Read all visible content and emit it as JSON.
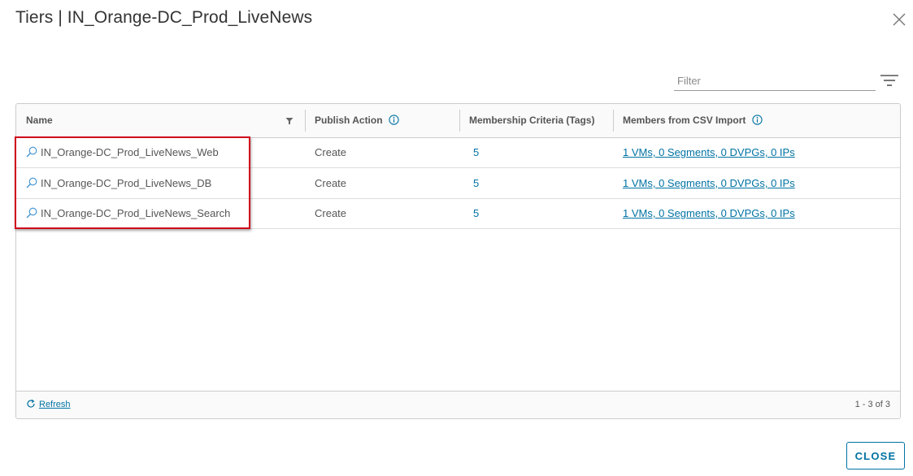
{
  "modal": {
    "title": "Tiers | IN_Orange-DC_Prod_LiveNews",
    "close_icon": "close-icon",
    "close_button_label": "CLOSE"
  },
  "filter": {
    "placeholder": "Filter",
    "value": "",
    "toggle_icon": "filter-lines-icon"
  },
  "grid": {
    "columns": [
      {
        "label": "Name",
        "icon": "filter-funnel-icon"
      },
      {
        "label": "Publish Action",
        "icon": "info-icon"
      },
      {
        "label": "Membership Criteria (Tags)"
      },
      {
        "label": "Members from CSV Import",
        "icon": "info-icon"
      }
    ],
    "rows": [
      {
        "name": "IN_Orange-DC_Prod_LiveNews_Web",
        "publish_action": "Create",
        "membership_tags": "5",
        "csv_members": "1 VMs, 0 Segments, 0 DVPGs, 0 IPs"
      },
      {
        "name": "IN_Orange-DC_Prod_LiveNews_DB",
        "publish_action": "Create",
        "membership_tags": "5",
        "csv_members": "1 VMs, 0 Segments, 0 DVPGs, 0 IPs"
      },
      {
        "name": "IN_Orange-DC_Prod_LiveNews_Search",
        "publish_action": "Create",
        "membership_tags": "5",
        "csv_members": "1 VMs, 0 Segments, 0 DVPGs, 0 IPs"
      }
    ],
    "footer": {
      "refresh_label": "Refresh",
      "count_text": "1 - 3 of 3"
    }
  },
  "colors": {
    "link": "#0072a3",
    "highlight": "#d0021b",
    "border": "#cccccc"
  }
}
